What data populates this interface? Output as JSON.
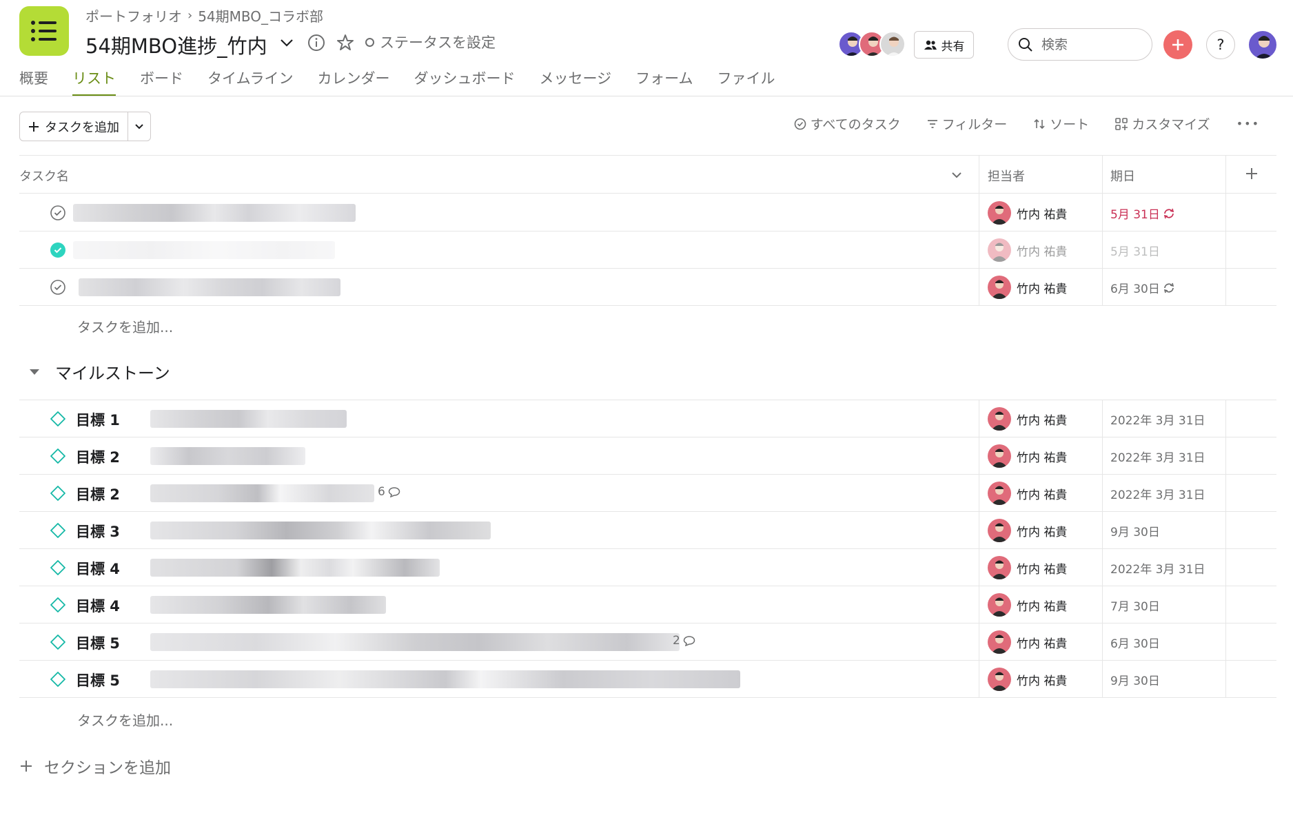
{
  "breadcrumb": {
    "parent": "ポートフォリオ",
    "separator": "›",
    "current": "54期MBO_コラボ部"
  },
  "project": {
    "title": "54期MBO進捗_竹内",
    "status_label": "ステータスを設定"
  },
  "header": {
    "share_label": "共有",
    "search_placeholder": "検索",
    "help_label": "?"
  },
  "tabs": [
    {
      "label": "概要",
      "active": false
    },
    {
      "label": "リスト",
      "active": true
    },
    {
      "label": "ボード",
      "active": false
    },
    {
      "label": "タイムライン",
      "active": false
    },
    {
      "label": "カレンダー",
      "active": false
    },
    {
      "label": "ダッシュボード",
      "active": false
    },
    {
      "label": "メッセージ",
      "active": false
    },
    {
      "label": "フォーム",
      "active": false
    },
    {
      "label": "ファイル",
      "active": false
    }
  ],
  "toolbar": {
    "add_task_label": "タスクを追加",
    "all_tasks_label": "すべてのタスク",
    "filter_label": "フィルター",
    "sort_label": "ソート",
    "customize_label": "カスタマイズ",
    "more_label": "•••"
  },
  "columns": {
    "task_name": "タスク名",
    "assignee": "担当者",
    "due": "期日"
  },
  "tasks": [
    {
      "assignee": "竹内 祐貴",
      "due": "5月 31日",
      "completed": false,
      "overdue": true,
      "recurring": true
    },
    {
      "assignee": "竹内 祐貴",
      "due": "5月 31日",
      "completed": true,
      "overdue": false,
      "recurring": false
    },
    {
      "assignee": "竹内 祐貴",
      "due": "6月 30日",
      "completed": false,
      "overdue": false,
      "recurring": true
    }
  ],
  "add_task_inline": "タスクを追加...",
  "milestone_section": {
    "title": "マイルストーン",
    "items": [
      {
        "label": "目標 1",
        "assignee": "竹内 祐貴",
        "due": "2022年 3月 31日",
        "comments": ""
      },
      {
        "label": "目標 2",
        "assignee": "竹内 祐貴",
        "due": "2022年 3月 31日",
        "comments": ""
      },
      {
        "label": "目標 2",
        "assignee": "竹内 祐貴",
        "due": "2022年 3月 31日",
        "comments": "6"
      },
      {
        "label": "目標 3",
        "assignee": "竹内 祐貴",
        "due": "9月 30日",
        "comments": ""
      },
      {
        "label": "目標 4",
        "assignee": "竹内 祐貴",
        "due": "2022年 3月 31日",
        "comments": ""
      },
      {
        "label": "目標 4",
        "assignee": "竹内 祐貴",
        "due": "7月 30日",
        "comments": ""
      },
      {
        "label": "目標 5",
        "assignee": "竹内 祐貴",
        "due": "6月 30日",
        "comments": "2"
      },
      {
        "label": "目標 5",
        "assignee": "竹内 祐貴",
        "due": "9月 30日",
        "comments": ""
      }
    ]
  },
  "add_section_label": "セクションを追加",
  "colors": {
    "accent_green": "#6a8d15",
    "app_icon": "#b4dc36",
    "overdue": "#c92f54",
    "complete": "#2dd4bf",
    "milestone": "#14b8a6",
    "plus": "#f06a6a"
  }
}
